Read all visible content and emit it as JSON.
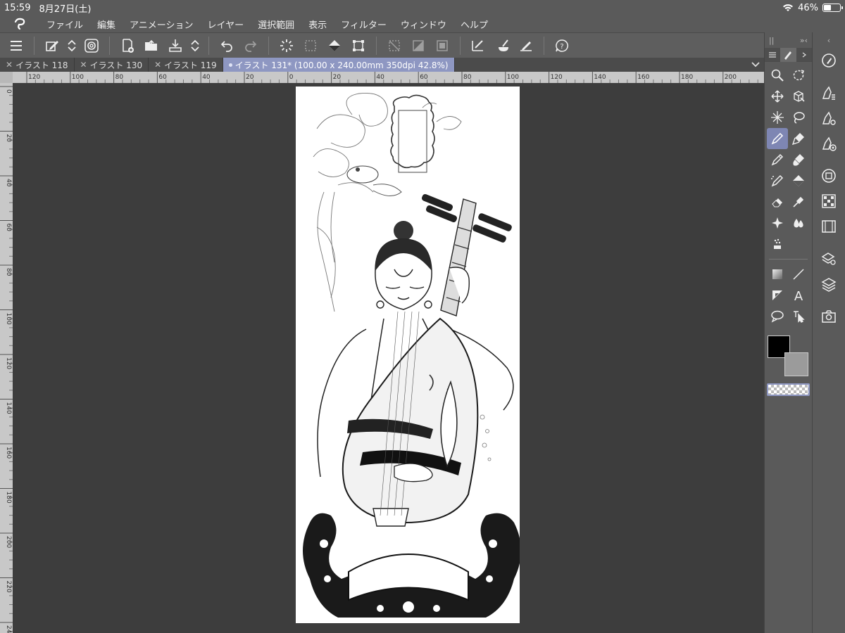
{
  "status": {
    "time": "15:59",
    "date": "8月27日(土)",
    "battery": "46%",
    "battery_level": 0.46
  },
  "menu": {
    "items": [
      "ファイル",
      "編集",
      "アニメーション",
      "レイヤー",
      "選択範囲",
      "表示",
      "フィルター",
      "ウィンドウ",
      "ヘルプ"
    ]
  },
  "tabs": [
    {
      "label": "イラスト 118",
      "active": false
    },
    {
      "label": "イラスト 130",
      "active": false
    },
    {
      "label": "イラスト 119",
      "active": false
    },
    {
      "label": "イラスト 131* (100.00 x 240.00mm 350dpi 42.8%)",
      "active": true
    }
  ],
  "ruler": {
    "h": [
      "120",
      "100",
      "80",
      "60",
      "40",
      "20",
      "0",
      "20",
      "40",
      "60",
      "80",
      "100",
      "120",
      "140",
      "160",
      "180",
      "200"
    ],
    "v": [
      "0",
      "20",
      "40",
      "60",
      "80",
      "100",
      "120",
      "140",
      "160",
      "180",
      "200",
      "220",
      "240"
    ]
  },
  "toolbar": {
    "icons": [
      "menu-icon",
      "edit-icon",
      "updown-icon",
      "spiral-icon",
      "new-file-icon",
      "open-folder-icon",
      "save-icon",
      "updown-icon",
      "undo-icon",
      "redo-icon",
      "spinner-icon",
      "selection-icon",
      "fill-icon",
      "transform-icon",
      "deselect-icon",
      "invert-icon",
      "crop-icon",
      "ruler-icon",
      "brush-icon",
      "pen-icon",
      "help-icon"
    ]
  },
  "palette": {
    "head_left": "||",
    "head_right": "»‹",
    "tools": [
      "zoom-icon",
      "rotate-icon",
      "move-icon",
      "object-icon",
      "sparkle-icon",
      "lasso-icon",
      "pen-icon",
      "marker-icon",
      "pencil-icon",
      "brush-icon",
      "airbrush-icon",
      "fill-icon",
      "eraser-icon",
      "eyedropper-icon",
      "blend-icon",
      "water-icon",
      "decoration-icon",
      "gradient-icon",
      "line-icon",
      "figure-icon",
      "text-icon",
      "balloon-icon",
      "operation-icon"
    ],
    "colors": {
      "main": "#000000",
      "sub": "#9b9b9b"
    }
  },
  "cmdbar": {
    "head": "‹",
    "icons": [
      "copilot-icon",
      "pen-settings-icon",
      "pen-gear-icon",
      "pen-target-icon",
      "color-wheel-icon",
      "grid-palette-icon",
      "film-icon",
      "layer-property-icon",
      "layers-icon",
      "camera-icon"
    ]
  },
  "accent": "#8e97c2"
}
